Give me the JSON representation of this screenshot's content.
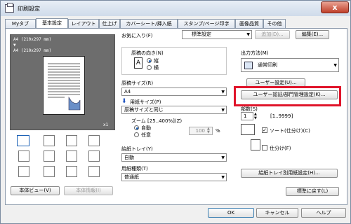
{
  "window": {
    "title": "印刷設定",
    "close_glyph": "x"
  },
  "tabs": [
    {
      "label": "Myタブ"
    },
    {
      "label": "基本設定"
    },
    {
      "label": "レイアウト"
    },
    {
      "label": "仕上げ"
    },
    {
      "label": "カバーシート/挿入紙"
    },
    {
      "label": "スタンプ/ページ印字"
    },
    {
      "label": "画像品質"
    },
    {
      "label": "その他"
    }
  ],
  "preview": {
    "line1": "A4 (210x297 mm)",
    "arrow": "▼",
    "line2": "A4 (210x297 mm)",
    "zoom": "x1"
  },
  "bottom_left": {
    "view_button": "本体ビュー(V)",
    "info_button": "本体情報(I)"
  },
  "favorites": {
    "label": "お気に入り(F)",
    "value": "標準設定",
    "add_button": "追加(D)...",
    "edit_button": "編集(E)..."
  },
  "orientation": {
    "label": "原稿の向き(N)",
    "portrait": "縦",
    "landscape": "横",
    "selected": "portrait"
  },
  "original_size": {
    "label": "原稿サイズ(R)",
    "value": "A4"
  },
  "paper_size": {
    "label": "用紙サイズ(P)",
    "value": "原稿サイズと同じ"
  },
  "zoom": {
    "label": "ズーム [25..400%](Z)",
    "auto": "自動",
    "arbitrary": "任意",
    "value": "100",
    "unit": "%"
  },
  "paper_tray": {
    "label": "給紙トレイ(Y)",
    "value": "自動"
  },
  "paper_type": {
    "label": "用紙種類(T)",
    "value": "普通紙"
  },
  "output_method": {
    "label": "出力方法(M)",
    "value": "通常印刷",
    "user_settings_button": "ユーザー設定(U)...",
    "auth_button": "ユーザー認証/部門管理設定(K)..."
  },
  "copies": {
    "label": "部数(S)",
    "value": "1",
    "range": "[1..9999]",
    "collate_label": "ソート(仕分け)(C)",
    "collate_checked": true,
    "offset_label": "仕分け(F)",
    "offset_checked": false
  },
  "tray_paper_button": "給紙トレイ別用紙設定(H)...",
  "restore_button": "標準に戻す(L)",
  "footer": {
    "ok": "OK",
    "cancel": "キャンセル",
    "help": "ヘルプ"
  }
}
